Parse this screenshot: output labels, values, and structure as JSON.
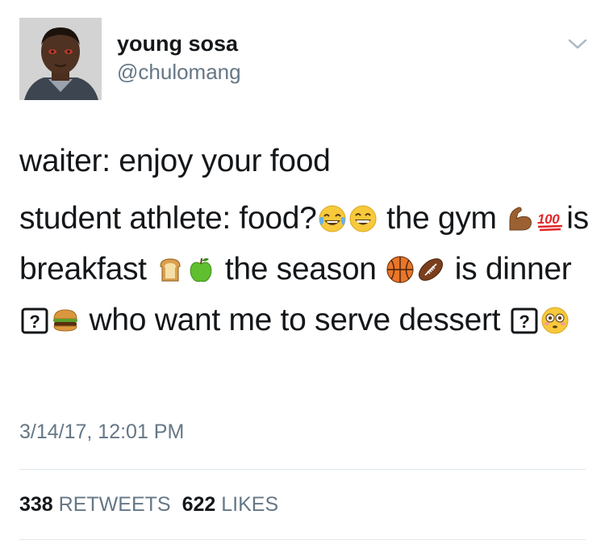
{
  "tweet": {
    "display_name": "young sosa",
    "handle": "@chulomang",
    "avatar_icon": "avatar-photo",
    "menu_icon": "chevron-down-icon",
    "line1": "waiter: enjoy your food",
    "line2_a": "student athlete: food?",
    "line2_b": "the gym",
    "line2_c": "is breakfast",
    "line2_d": "the season",
    "line2_e": "is dinner",
    "line2_f": "who want me to serve dessert",
    "timestamp": "3/14/17, 12:01 PM",
    "retweets_count": "338",
    "retweets_label": "RETWEETS",
    "likes_count": "622",
    "likes_label": "LIKES"
  },
  "emojis": [
    "face-with-tears-of-joy",
    "grinning-face-with-smiling-eyes",
    "flexed-biceps",
    "hundred-points",
    "bread",
    "green-apple",
    "basketball",
    "american-football",
    "question-mark-box",
    "hamburger",
    "question-mark-box",
    "flushed-face"
  ],
  "colors": {
    "text": "#14171a",
    "secondary": "#657786",
    "divider": "#e1e8ed"
  }
}
